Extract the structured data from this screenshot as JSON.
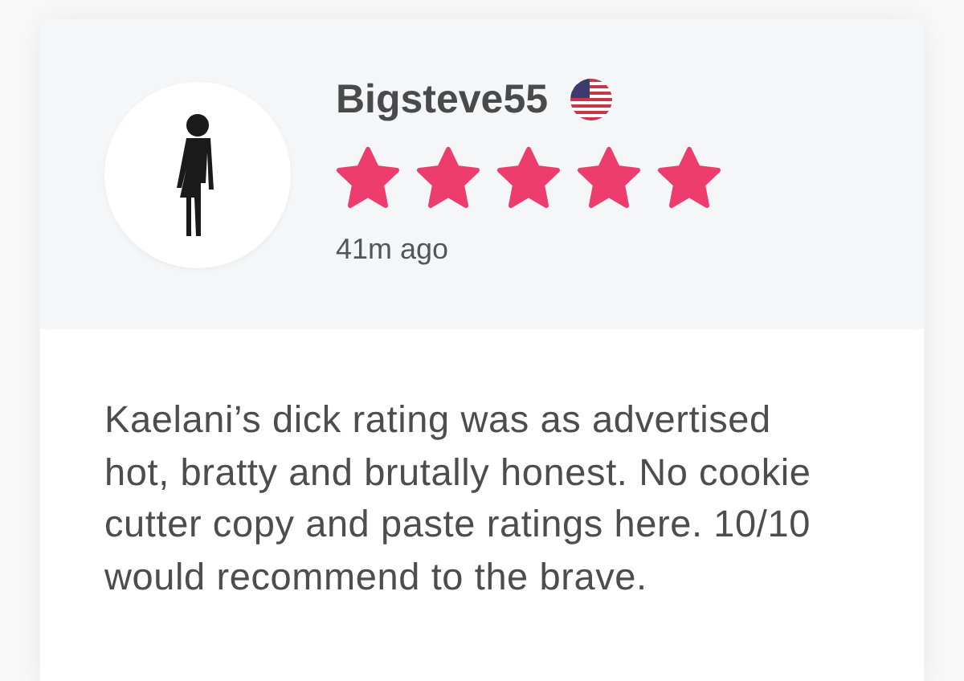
{
  "review": {
    "author": "Bigsteve55",
    "stars": 5,
    "time": "41m ago",
    "text": "Kaelani’s dick rating was as advertised hot, bratty and brutally honest. No cookie cutter copy and paste ratings here. 10/10 would recommend to the brave."
  }
}
